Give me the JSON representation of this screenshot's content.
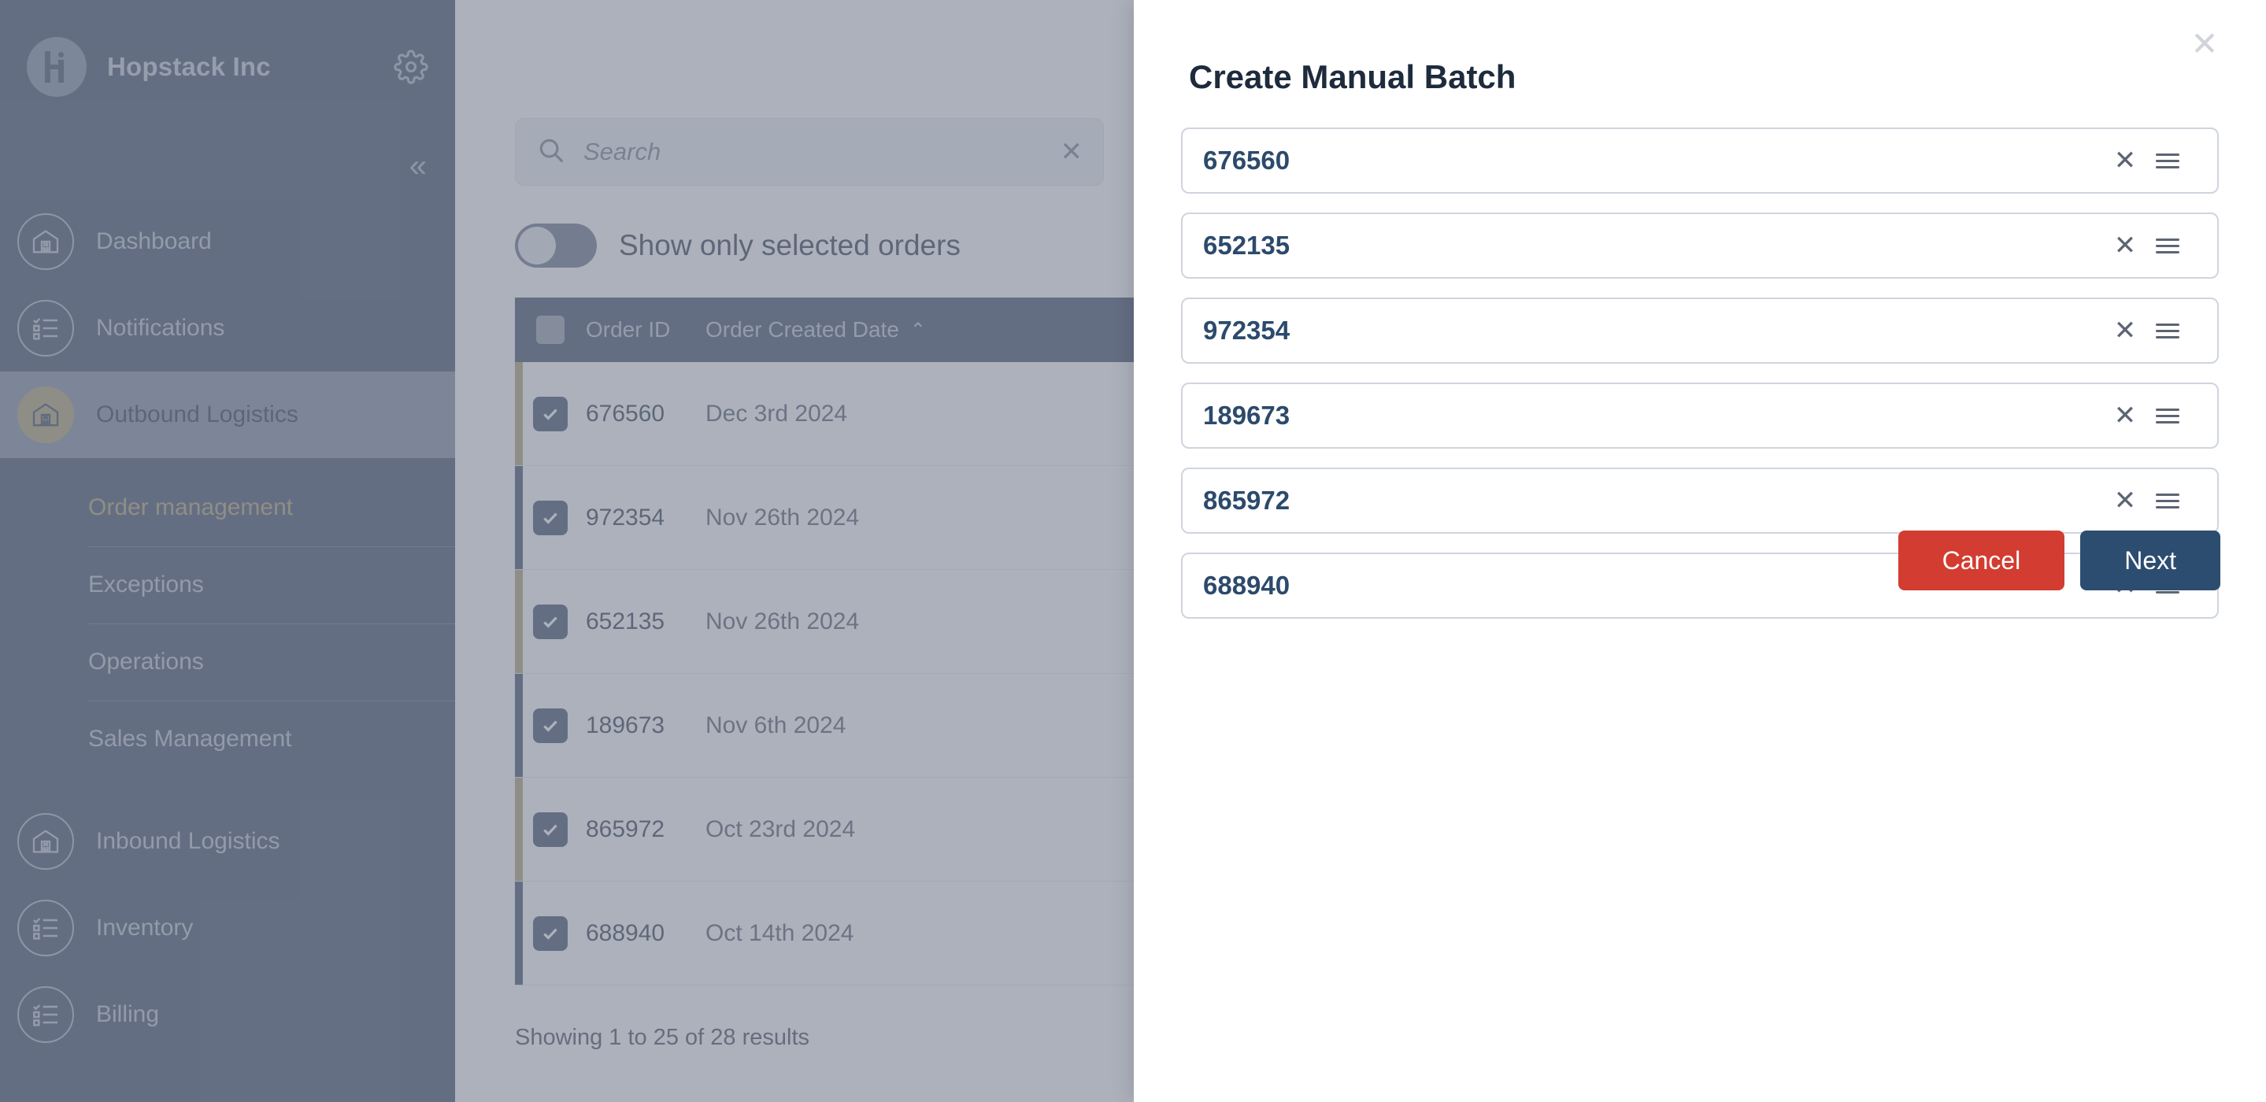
{
  "sidebar": {
    "brand": "Hopstack Inc",
    "logo_icon": "hopstack-logo-icon",
    "settings_icon": "gear-icon",
    "collapse_icon": "double-chevron-left-icon",
    "collapse_label": "«",
    "items": [
      {
        "label": "Dashboard",
        "icon": "warehouse-icon",
        "active": false
      },
      {
        "label": "Notifications",
        "icon": "checklist-icon",
        "active": false
      },
      {
        "label": "Outbound Logistics",
        "icon": "warehouse-icon",
        "active": true
      },
      {
        "label": "Inbound Logistics",
        "icon": "warehouse-icon",
        "active": false
      },
      {
        "label": "Inventory",
        "icon": "checklist-icon",
        "active": false
      },
      {
        "label": "Billing",
        "icon": "checklist-icon",
        "active": false
      }
    ],
    "submenu": [
      {
        "label": "Order management",
        "active": true
      },
      {
        "label": "Exceptions",
        "active": false
      },
      {
        "label": "Operations",
        "active": false
      },
      {
        "label": "Sales Management",
        "active": false
      }
    ]
  },
  "main": {
    "search": {
      "placeholder": "Search",
      "value": "",
      "search_icon": "search-icon",
      "clear_icon": "close-icon",
      "clear_label": "✕",
      "filter_icon": "filter-icon"
    },
    "toggle": {
      "label": "Show only selected orders",
      "checked": false
    },
    "table": {
      "headers": [
        "Order ID",
        "Order Created Date"
      ],
      "sort_indicator": "⌃",
      "sort_column": "Order Created Date",
      "rows": [
        {
          "checked": true,
          "order_id": "676560",
          "date": "Dec 3rd 2024",
          "accent": "gold"
        },
        {
          "checked": true,
          "order_id": "972354",
          "date": "Nov 26th 2024",
          "accent": "blue"
        },
        {
          "checked": true,
          "order_id": "652135",
          "date": "Nov 26th 2024",
          "accent": "gold"
        },
        {
          "checked": true,
          "order_id": "189673",
          "date": "Nov 6th 2024",
          "accent": "blue"
        },
        {
          "checked": true,
          "order_id": "865972",
          "date": "Oct 23rd 2024",
          "accent": "gold"
        },
        {
          "checked": true,
          "order_id": "688940",
          "date": "Oct 14th 2024",
          "accent": "blue"
        }
      ]
    },
    "results_text": "Showing 1 to 25 of 28 results"
  },
  "modal": {
    "title": "Create Manual Batch",
    "close_icon": "close-icon",
    "close_label": "✕",
    "row_remove_icon": "close-icon",
    "row_remove_label": "✕",
    "row_drag_icon": "drag-handle-icon",
    "rows": [
      {
        "value": "676560"
      },
      {
        "value": "652135"
      },
      {
        "value": "972354"
      },
      {
        "value": "189673"
      },
      {
        "value": "865972"
      },
      {
        "value": "688940"
      }
    ],
    "cancel_label": "Cancel",
    "next_label": "Next"
  },
  "colors": {
    "sidebar_bg": "#5b6880",
    "accent_gold": "#bdaf86",
    "accent_navy": "#2c4d70",
    "danger_red": "#d33c31",
    "input_value": "#2c4a6b"
  }
}
